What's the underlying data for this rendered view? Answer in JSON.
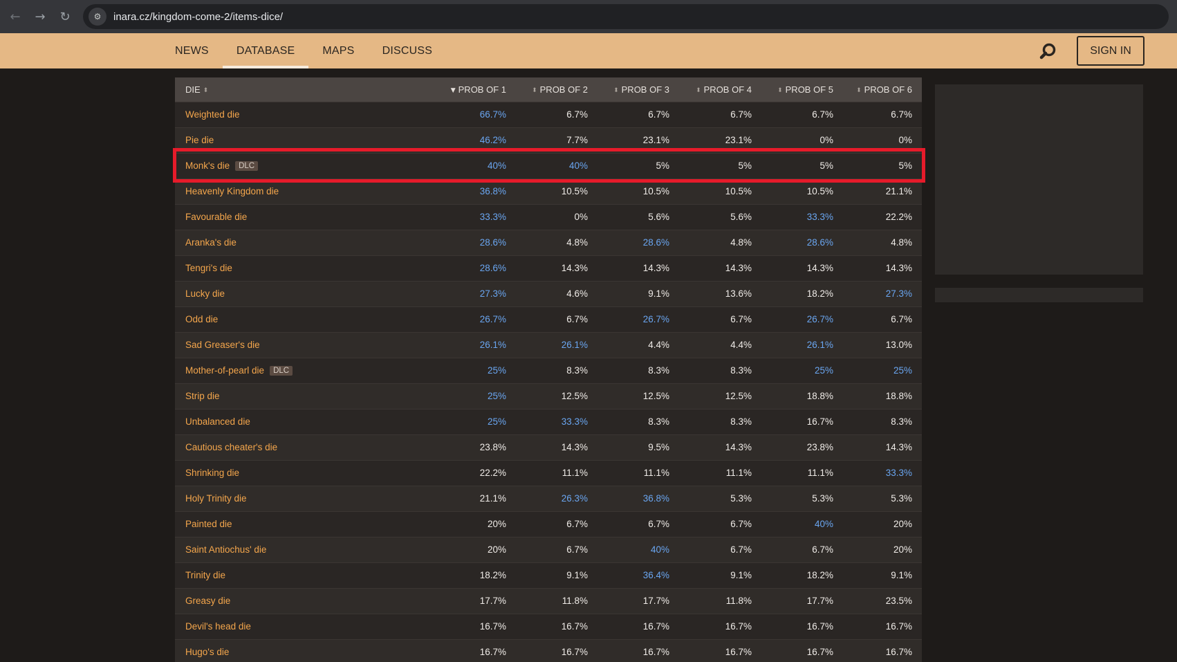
{
  "browser": {
    "url": "inara.cz/kingdom-come-2/items-dice/"
  },
  "menu": {
    "items": [
      "NEWS",
      "DATABASE",
      "MAPS",
      "DISCUSS"
    ],
    "active": "DATABASE",
    "sign_in": "SIGN IN"
  },
  "table": {
    "headers": [
      "DIE",
      "PROB OF 1",
      "PROB OF 2",
      "PROB OF 3",
      "PROB OF 4",
      "PROB OF 5",
      "PROB OF 6"
    ],
    "sorted_column": "PROB OF 1",
    "rows": [
      {
        "name": "Weighted die",
        "dlc": false,
        "values": [
          "66.7%",
          "6.7%",
          "6.7%",
          "6.7%",
          "6.7%",
          "6.7%"
        ],
        "highlighted": [
          true,
          false,
          false,
          false,
          false,
          false
        ]
      },
      {
        "name": "Pie die",
        "dlc": false,
        "values": [
          "46.2%",
          "7.7%",
          "23.1%",
          "23.1%",
          "0%",
          "0%"
        ],
        "highlighted": [
          true,
          false,
          false,
          false,
          false,
          false
        ]
      },
      {
        "name": "Monk's die",
        "dlc": true,
        "values": [
          "40%",
          "40%",
          "5%",
          "5%",
          "5%",
          "5%"
        ],
        "highlighted": [
          true,
          true,
          false,
          false,
          false,
          false
        ]
      },
      {
        "name": "Heavenly Kingdom die",
        "dlc": false,
        "values": [
          "36.8%",
          "10.5%",
          "10.5%",
          "10.5%",
          "10.5%",
          "21.1%"
        ],
        "highlighted": [
          true,
          false,
          false,
          false,
          false,
          false
        ]
      },
      {
        "name": "Favourable die",
        "dlc": false,
        "values": [
          "33.3%",
          "0%",
          "5.6%",
          "5.6%",
          "33.3%",
          "22.2%"
        ],
        "highlighted": [
          true,
          false,
          false,
          false,
          true,
          false
        ]
      },
      {
        "name": "Aranka's die",
        "dlc": false,
        "values": [
          "28.6%",
          "4.8%",
          "28.6%",
          "4.8%",
          "28.6%",
          "4.8%"
        ],
        "highlighted": [
          true,
          false,
          true,
          false,
          true,
          false
        ]
      },
      {
        "name": "Tengri's die",
        "dlc": false,
        "values": [
          "28.6%",
          "14.3%",
          "14.3%",
          "14.3%",
          "14.3%",
          "14.3%"
        ],
        "highlighted": [
          true,
          false,
          false,
          false,
          false,
          false
        ]
      },
      {
        "name": "Lucky die",
        "dlc": false,
        "values": [
          "27.3%",
          "4.6%",
          "9.1%",
          "13.6%",
          "18.2%",
          "27.3%"
        ],
        "highlighted": [
          true,
          false,
          false,
          false,
          false,
          true
        ]
      },
      {
        "name": "Odd die",
        "dlc": false,
        "values": [
          "26.7%",
          "6.7%",
          "26.7%",
          "6.7%",
          "26.7%",
          "6.7%"
        ],
        "highlighted": [
          true,
          false,
          true,
          false,
          true,
          false
        ]
      },
      {
        "name": "Sad Greaser's die",
        "dlc": false,
        "values": [
          "26.1%",
          "26.1%",
          "4.4%",
          "4.4%",
          "26.1%",
          "13.0%"
        ],
        "highlighted": [
          true,
          true,
          false,
          false,
          true,
          false
        ]
      },
      {
        "name": "Mother-of-pearl die",
        "dlc": true,
        "values": [
          "25%",
          "8.3%",
          "8.3%",
          "8.3%",
          "25%",
          "25%"
        ],
        "highlighted": [
          true,
          false,
          false,
          false,
          true,
          true
        ]
      },
      {
        "name": "Strip die",
        "dlc": false,
        "values": [
          "25%",
          "12.5%",
          "12.5%",
          "12.5%",
          "18.8%",
          "18.8%"
        ],
        "highlighted": [
          true,
          false,
          false,
          false,
          false,
          false
        ]
      },
      {
        "name": "Unbalanced die",
        "dlc": false,
        "values": [
          "25%",
          "33.3%",
          "8.3%",
          "8.3%",
          "16.7%",
          "8.3%"
        ],
        "highlighted": [
          true,
          true,
          false,
          false,
          false,
          false
        ]
      },
      {
        "name": "Cautious cheater's die",
        "dlc": false,
        "values": [
          "23.8%",
          "14.3%",
          "9.5%",
          "14.3%",
          "23.8%",
          "14.3%"
        ],
        "highlighted": [
          false,
          false,
          false,
          false,
          false,
          false
        ]
      },
      {
        "name": "Shrinking die",
        "dlc": false,
        "values": [
          "22.2%",
          "11.1%",
          "11.1%",
          "11.1%",
          "11.1%",
          "33.3%"
        ],
        "highlighted": [
          false,
          false,
          false,
          false,
          false,
          true
        ]
      },
      {
        "name": "Holy Trinity die",
        "dlc": false,
        "values": [
          "21.1%",
          "26.3%",
          "36.8%",
          "5.3%",
          "5.3%",
          "5.3%"
        ],
        "highlighted": [
          false,
          true,
          true,
          false,
          false,
          false
        ]
      },
      {
        "name": "Painted die",
        "dlc": false,
        "values": [
          "20%",
          "6.7%",
          "6.7%",
          "6.7%",
          "40%",
          "20%"
        ],
        "highlighted": [
          false,
          false,
          false,
          false,
          true,
          false
        ]
      },
      {
        "name": "Saint Antiochus' die",
        "dlc": false,
        "values": [
          "20%",
          "6.7%",
          "40%",
          "6.7%",
          "6.7%",
          "20%"
        ],
        "highlighted": [
          false,
          false,
          true,
          false,
          false,
          false
        ]
      },
      {
        "name": "Trinity die",
        "dlc": false,
        "values": [
          "18.2%",
          "9.1%",
          "36.4%",
          "9.1%",
          "18.2%",
          "9.1%"
        ],
        "highlighted": [
          false,
          false,
          true,
          false,
          false,
          false
        ]
      },
      {
        "name": "Greasy die",
        "dlc": false,
        "values": [
          "17.7%",
          "11.8%",
          "17.7%",
          "11.8%",
          "17.7%",
          "23.5%"
        ],
        "highlighted": [
          false,
          false,
          false,
          false,
          false,
          false
        ]
      },
      {
        "name": "Devil's head die",
        "dlc": false,
        "values": [
          "16.7%",
          "16.7%",
          "16.7%",
          "16.7%",
          "16.7%",
          "16.7%"
        ],
        "highlighted": [
          false,
          false,
          false,
          false,
          false,
          false
        ]
      },
      {
        "name": "Hugo's die",
        "dlc": false,
        "values": [
          "16.7%",
          "16.7%",
          "16.7%",
          "16.7%",
          "16.7%",
          "16.7%"
        ],
        "highlighted": [
          false,
          false,
          false,
          false,
          false,
          false
        ]
      }
    ],
    "dlc_label": "DLC",
    "highlighted_row": "Monk's die"
  },
  "colors": {
    "header_bg": "#e5b885",
    "die_name": "#f4a64c",
    "highlight_value": "#6aa6f1",
    "annotation_box": "#e61b2a"
  }
}
